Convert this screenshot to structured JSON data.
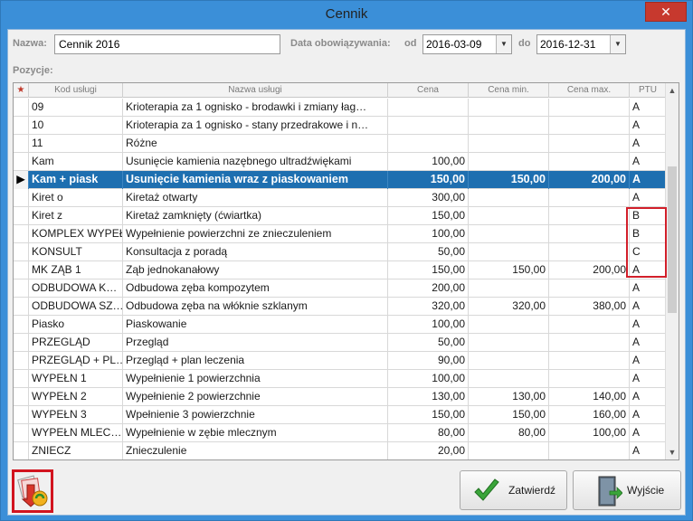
{
  "window": {
    "title": "Cennik",
    "close_glyph": "✕"
  },
  "form": {
    "name_label": "Nazwa:",
    "name_value": "Cennik 2016",
    "validity_label": "Data obowiązywania:",
    "from_label": "od",
    "from_value": "2016-03-09",
    "to_label": "do",
    "to_value": "2016-12-31",
    "positions_label": "Pozycje:"
  },
  "grid": {
    "indicator_header": "★",
    "columns": [
      "Kod usługi",
      "Nazwa usługi",
      "Cena",
      "Cena min.",
      "Cena max.",
      "PTU"
    ],
    "rows": [
      [
        "09",
        "Krioterapia za 1 ognisko - brodawki i zmiany łag…",
        "",
        "",
        "",
        "A"
      ],
      [
        "10",
        "Krioterapia za 1 ognisko - stany przedrakowe i n…",
        "",
        "",
        "",
        "A"
      ],
      [
        "11",
        "Różne",
        "",
        "",
        "",
        "A"
      ],
      [
        "Kam",
        "Usunięcie kamienia nazębnego ultradźwiękami",
        "100,00",
        "",
        "",
        "A"
      ],
      [
        "Kam + piask",
        "Usunięcie kamienia wraz z piaskowaniem",
        "150,00",
        "150,00",
        "200,00",
        "A"
      ],
      [
        "Kiret o",
        "Kiretaż otwarty",
        "300,00",
        "",
        "",
        "A"
      ],
      [
        "Kiret z",
        "Kiretaż zamknięty (ćwiartka)",
        "150,00",
        "",
        "",
        "B"
      ],
      [
        "KOMPLEX WYPEŁ",
        "Wypełnienie powierzchni ze znieczuleniem",
        "100,00",
        "",
        "",
        "B"
      ],
      [
        "KONSULT",
        "Konsultacja z poradą",
        "50,00",
        "",
        "",
        "C"
      ],
      [
        "MK ZĄB 1",
        "Ząb jednokanałowy",
        "150,00",
        "150,00",
        "200,00",
        "A"
      ],
      [
        "ODBUDOWA K…",
        "Odbudowa zęba kompozytem",
        "200,00",
        "",
        "",
        "A"
      ],
      [
        "ODBUDOWA SZ…",
        "Odbudowa zęba na włóknie szklanym",
        "320,00",
        "320,00",
        "380,00",
        "A"
      ],
      [
        "Piasko",
        "Piaskowanie",
        "100,00",
        "",
        "",
        "A"
      ],
      [
        "PRZEGLĄD",
        "Przegląd",
        "50,00",
        "",
        "",
        "A"
      ],
      [
        "PRZEGLĄD + PL…",
        "Przegląd + plan leczenia",
        "90,00",
        "",
        "",
        "A"
      ],
      [
        "WYPEŁN 1",
        "Wypełnienie 1 powierzchnia",
        "100,00",
        "",
        "",
        "A"
      ],
      [
        "WYPEŁN 2",
        "Wypełnienie 2 powierzchnie",
        "130,00",
        "130,00",
        "140,00",
        "A"
      ],
      [
        "WYPEŁN 3",
        "Wpełnienie 3 powierzchnie",
        "150,00",
        "150,00",
        "160,00",
        "A"
      ],
      [
        "WYPEŁN MLEC…",
        "Wypełnienie w zębie mlecznym",
        "80,00",
        "80,00",
        "100,00",
        "A"
      ],
      [
        "ZNIECZ",
        "Znieczulenie",
        "20,00",
        "",
        "",
        "A"
      ]
    ],
    "selected_row": 4,
    "current_row_glyph": "▶"
  },
  "buttons": {
    "confirm_label": "Zatwierdź",
    "exit_label": "Wyjście"
  },
  "colors": {
    "accent": "#1e6fb0",
    "highlight": "#d21f2a"
  },
  "icons": {
    "tool_icon": "export-price-list-icon",
    "confirm_icon": "checkmark-icon",
    "exit_icon": "door-exit-icon"
  }
}
